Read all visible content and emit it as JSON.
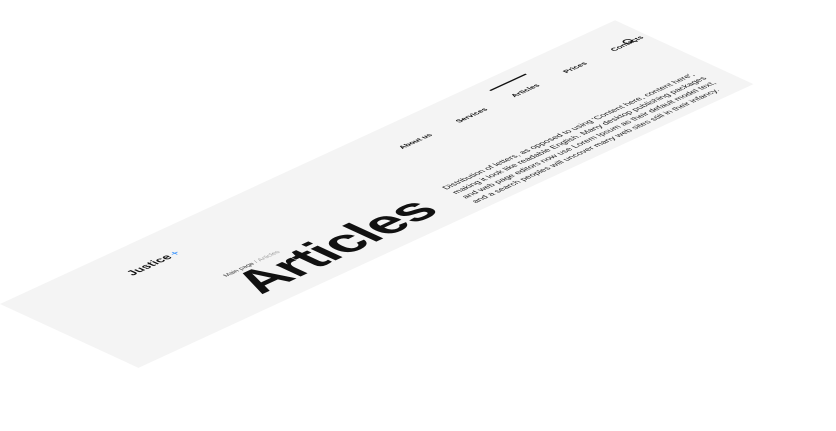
{
  "header": {
    "logo": "Justice",
    "logo_mark": "+"
  },
  "nav": {
    "items": [
      {
        "label": "About us",
        "active": false
      },
      {
        "label": "Services",
        "active": false
      },
      {
        "label": "Articles",
        "active": true
      },
      {
        "label": "Prices",
        "active": false
      },
      {
        "label": "Contacts",
        "active": false
      }
    ],
    "search_icon": "search-icon"
  },
  "breadcrumb": {
    "home": "Main page",
    "separator": "/",
    "current": "Articles"
  },
  "main": {
    "title": "Articles",
    "description": "Distribution of letters, as opposed to using 'Content here, content here', making it look like readable English. Many desktop publishing packages and web page editors now use Lorem Ipsum as their default model text, and a search peoples will uncover many web sites still in their infancy."
  },
  "colors": {
    "accent": "#2a8cff",
    "background": "#f4f4f4",
    "text": "#111111"
  }
}
